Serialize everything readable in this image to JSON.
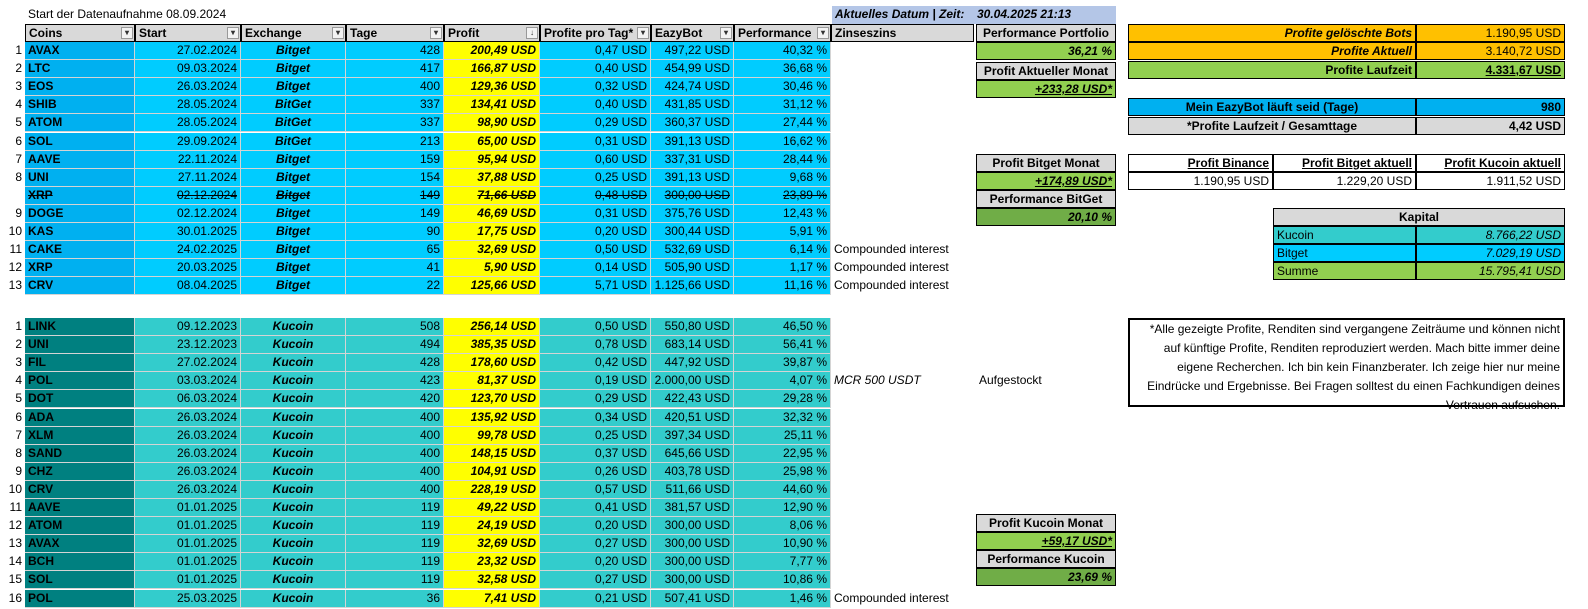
{
  "sheet_title": "Start der Datenaufnahme 08.09.2024",
  "datetime": {
    "label": "Aktuelles Datum | Zeit:",
    "value": "30.04.2025 21:13"
  },
  "headers": {
    "coins": "Coins",
    "start": "Start",
    "exchange": "Exchange",
    "tage": "Tage",
    "profit": "Profit",
    "ppt": "Profite pro Tag*",
    "eazybot": "EazyBot",
    "performance": "Performance",
    "zinseszins": "Zinseszins"
  },
  "filter_glyph": "▾",
  "sort_glyph": "↓",
  "bitget_rows": [
    {
      "n": "1",
      "coin": "AVAX",
      "start": "27.02.2024",
      "exchange": "Bitget",
      "tage": "428",
      "profit": "200,49 USD",
      "ppt": "0,47 USD",
      "eazybot": "497,22 USD",
      "perf": "40,32 %",
      "note": ""
    },
    {
      "n": "2",
      "coin": "LTC",
      "start": "09.03.2024",
      "exchange": "Bitget",
      "tage": "417",
      "profit": "166,87 USD",
      "ppt": "0,40 USD",
      "eazybot": "454,99 USD",
      "perf": "36,68 %",
      "note": ""
    },
    {
      "n": "3",
      "coin": "EOS",
      "start": "26.03.2024",
      "exchange": "Bitget",
      "tage": "400",
      "profit": "129,36 USD",
      "ppt": "0,32 USD",
      "eazybot": "424,74 USD",
      "perf": "30,46 %",
      "note": ""
    },
    {
      "n": "4",
      "coin": "SHIB",
      "start": "28.05.2024",
      "exchange": "BitGet",
      "tage": "337",
      "profit": "134,41 USD",
      "ppt": "0,40 USD",
      "eazybot": "431,85 USD",
      "perf": "31,12 %",
      "note": ""
    },
    {
      "n": "5",
      "coin": "ATOM",
      "start": "28.05.2024",
      "exchange": "BitGet",
      "tage": "337",
      "profit": "98,90 USD",
      "ppt": "0,29 USD",
      "eazybot": "360,37 USD",
      "perf": "27,44 %",
      "note": ""
    },
    {
      "n": "6",
      "coin": "SOL",
      "start": "29.09.2024",
      "exchange": "BitGet",
      "tage": "213",
      "profit": "65,00 USD",
      "ppt": "0,31 USD",
      "eazybot": "391,13 USD",
      "perf": "16,62 %",
      "note": ""
    },
    {
      "n": "7",
      "coin": "AAVE",
      "start": "22.11.2024",
      "exchange": "Bitget",
      "tage": "159",
      "profit": "95,94 USD",
      "ppt": "0,60 USD",
      "eazybot": "337,31 USD",
      "perf": "28,44 %",
      "note": ""
    },
    {
      "n": "8",
      "coin": "UNI",
      "start": "27.11.2024",
      "exchange": "Bitget",
      "tage": "154",
      "profit": "37,88 USD",
      "ppt": "0,25 USD",
      "eazybot": "391,13 USD",
      "perf": "9,68 %",
      "note": ""
    },
    {
      "n": "",
      "coin": "XRP",
      "start": "02.12.2024",
      "exchange": "Bitget",
      "tage": "149",
      "profit": "71,66 USD",
      "ppt": "0,48 USD",
      "eazybot": "300,00 USD",
      "perf": "23,89 %",
      "note": "",
      "struck": true
    },
    {
      "n": "9",
      "coin": "DOGE",
      "start": "02.12.2024",
      "exchange": "Bitget",
      "tage": "149",
      "profit": "46,69 USD",
      "ppt": "0,31 USD",
      "eazybot": "375,76 USD",
      "perf": "12,43 %",
      "note": ""
    },
    {
      "n": "10",
      "coin": "KAS",
      "start": "30.01.2025",
      "exchange": "Bitget",
      "tage": "90",
      "profit": "17,75 USD",
      "ppt": "0,20 USD",
      "eazybot": "300,44 USD",
      "perf": "5,91 %",
      "note": ""
    },
    {
      "n": "11",
      "coin": "CAKE",
      "start": "24.02.2025",
      "exchange": "Bitget",
      "tage": "65",
      "profit": "32,69 USD",
      "ppt": "0,50 USD",
      "eazybot": "532,69 USD",
      "perf": "6,14 %",
      "note": "Compounded interest"
    },
    {
      "n": "12",
      "coin": "XRP",
      "start": "20.03.2025",
      "exchange": "Bitget",
      "tage": "41",
      "profit": "5,90 USD",
      "ppt": "0,14 USD",
      "eazybot": "505,90 USD",
      "perf": "1,17 %",
      "note": "Compounded interest"
    },
    {
      "n": "13",
      "coin": "CRV",
      "start": "08.04.2025",
      "exchange": "Bitget",
      "tage": "22",
      "profit": "125,66 USD",
      "ppt": "5,71 USD",
      "eazybot": "1.125,66 USD",
      "perf": "11,16 %",
      "note": "Compounded interest"
    }
  ],
  "kucoin_rows": [
    {
      "n": "1",
      "coin": "LINK",
      "start": "09.12.2023",
      "exchange": "Kucoin",
      "tage": "508",
      "profit": "256,14 USD",
      "ppt": "0,50 USD",
      "eazybot": "550,80 USD",
      "perf": "46,50 %",
      "note": ""
    },
    {
      "n": "2",
      "coin": "UNI",
      "start": "23.12.2023",
      "exchange": "Kucoin",
      "tage": "494",
      "profit": "385,35 USD",
      "ppt": "0,78 USD",
      "eazybot": "683,14 USD",
      "perf": "56,41 %",
      "note": ""
    },
    {
      "n": "3",
      "coin": "FIL",
      "start": "27.02.2024",
      "exchange": "Kucoin",
      "tage": "428",
      "profit": "178,60 USD",
      "ppt": "0,42 USD",
      "eazybot": "447,92 USD",
      "perf": "39,87 %",
      "note": ""
    },
    {
      "n": "4",
      "coin": "POL",
      "start": "03.03.2024",
      "exchange": "Kucoin",
      "tage": "423",
      "profit": "81,37 USD",
      "ppt": "0,19 USD",
      "eazybot": "2.000,00 USD",
      "perf": "4,07 %",
      "note": "MCR 500 USDT",
      "extra": "Aufgestockt"
    },
    {
      "n": "5",
      "coin": "DOT",
      "start": "06.03.2024",
      "exchange": "Kucoin",
      "tage": "420",
      "profit": "123,70 USD",
      "ppt": "0,29 USD",
      "eazybot": "422,43 USD",
      "perf": "29,28 %",
      "note": ""
    },
    {
      "n": "6",
      "coin": "ADA",
      "start": "26.03.2024",
      "exchange": "Kucoin",
      "tage": "400",
      "profit": "135,92 USD",
      "ppt": "0,34 USD",
      "eazybot": "420,51 USD",
      "perf": "32,32 %",
      "note": ""
    },
    {
      "n": "7",
      "coin": "XLM",
      "start": "26.03.2024",
      "exchange": "Kucoin",
      "tage": "400",
      "profit": "99,78 USD",
      "ppt": "0,25 USD",
      "eazybot": "397,34 USD",
      "perf": "25,11 %",
      "note": ""
    },
    {
      "n": "8",
      "coin": "SAND",
      "start": "26.03.2024",
      "exchange": "Kucoin",
      "tage": "400",
      "profit": "148,15 USD",
      "ppt": "0,37 USD",
      "eazybot": "645,66 USD",
      "perf": "22,95 %",
      "note": ""
    },
    {
      "n": "9",
      "coin": "CHZ",
      "start": "26.03.2024",
      "exchange": "Kucoin",
      "tage": "400",
      "profit": "104,91 USD",
      "ppt": "0,26 USD",
      "eazybot": "403,78 USD",
      "perf": "25,98 %",
      "note": ""
    },
    {
      "n": "10",
      "coin": "CRV",
      "start": "26.03.2024",
      "exchange": "Kucoin",
      "tage": "400",
      "profit": "228,19 USD",
      "ppt": "0,57 USD",
      "eazybot": "511,66 USD",
      "perf": "44,60 %",
      "note": ""
    },
    {
      "n": "11",
      "coin": "AAVE",
      "start": "01.01.2025",
      "exchange": "Kucoin",
      "tage": "119",
      "profit": "49,22 USD",
      "ppt": "0,41 USD",
      "eazybot": "381,57 USD",
      "perf": "12,90 %",
      "note": ""
    },
    {
      "n": "12",
      "coin": "ATOM",
      "start": "01.01.2025",
      "exchange": "Kucoin",
      "tage": "119",
      "profit": "24,19 USD",
      "ppt": "0,20 USD",
      "eazybot": "300,00 USD",
      "perf": "8,06 %",
      "note": ""
    },
    {
      "n": "13",
      "coin": "AVAX",
      "start": "01.01.2025",
      "exchange": "Kucoin",
      "tage": "119",
      "profit": "32,69 USD",
      "ppt": "0,27 USD",
      "eazybot": "300,00 USD",
      "perf": "10,90 %",
      "note": ""
    },
    {
      "n": "14",
      "coin": "BCH",
      "start": "01.01.2025",
      "exchange": "Kucoin",
      "tage": "119",
      "profit": "23,32 USD",
      "ppt": "0,20 USD",
      "eazybot": "300,00 USD",
      "perf": "7,77 %",
      "note": ""
    },
    {
      "n": "15",
      "coin": "SOL",
      "start": "01.01.2025",
      "exchange": "Kucoin",
      "tage": "119",
      "profit": "32,58 USD",
      "ppt": "0,27 USD",
      "eazybot": "300,00 USD",
      "perf": "10,86 %",
      "note": ""
    },
    {
      "n": "16",
      "coin": "POL",
      "start": "25.03.2025",
      "exchange": "Kucoin",
      "tage": "36",
      "profit": "7,41 USD",
      "ppt": "0,21 USD",
      "eazybot": "507,41 USD",
      "perf": "1,46 %",
      "note": "Compounded interest"
    }
  ],
  "side": {
    "perf_portfolio_label": "Performance Portfolio",
    "perf_portfolio_value": "36,21 %",
    "profit_month_label": "Profit Aktueller Monat",
    "profit_month_value": "+233,28 USD*",
    "bitget_month_label": "Profit Bitget Monat",
    "bitget_month_value": "+174,89 USD*",
    "bitget_perf_label": "Performance BitGet",
    "bitget_perf_value": "20,10 %",
    "kucoin_month_label": "Profit Kucoin Monat",
    "kucoin_month_value": "+59,17 USD*",
    "kucoin_perf_label": "Performance Kucoin",
    "kucoin_perf_value": "23,69 %"
  },
  "summary": {
    "deleted_label": "Profite gelöschte Bots",
    "deleted_value": "1.190,95 USD",
    "current_label": "Profite Aktuell",
    "current_value": "3.140,72 USD",
    "runtime_label": "Profite Laufzeit",
    "runtime_value": "4.331,67 USD",
    "days_label": "Mein EazyBot läuft seid (Tage)",
    "days_value": "980",
    "per_day_label": "*Profite Laufzeit  / Gesamttage",
    "per_day_value": "4,42 USD"
  },
  "exchanges": {
    "binance_label": "Profit Binance",
    "binance_value": "1.190,95 USD",
    "bitget_label": "Profit Bitget aktuell",
    "bitget_value": "1.229,20 USD",
    "kucoin_label": "Profit Kucoin aktuell",
    "kucoin_value": "1.911,52 USD"
  },
  "kapital": {
    "title": "Kapital",
    "kucoin_label": "Kucoin",
    "kucoin_value": "8.766,22 USD",
    "bitget_label": "Bitget",
    "bitget_value": "7.029,19 USD",
    "sum_label": "Summe",
    "sum_value": "15.795,41 USD"
  },
  "disclaimer": "*Alle gezeigte Profite, Renditen sind vergangene Zeiträume und können nicht auf künftige Profite, Renditen reproduziert werden. Mach bitte immer deine eigene Recherchen. Ich bin kein Finanzberater. Ich zeige hier nur meine Eindrücke und Ergebnisse. Bei Fragen solltest du einen Fachkundigen deines Vertrauen aufsuchen."
}
